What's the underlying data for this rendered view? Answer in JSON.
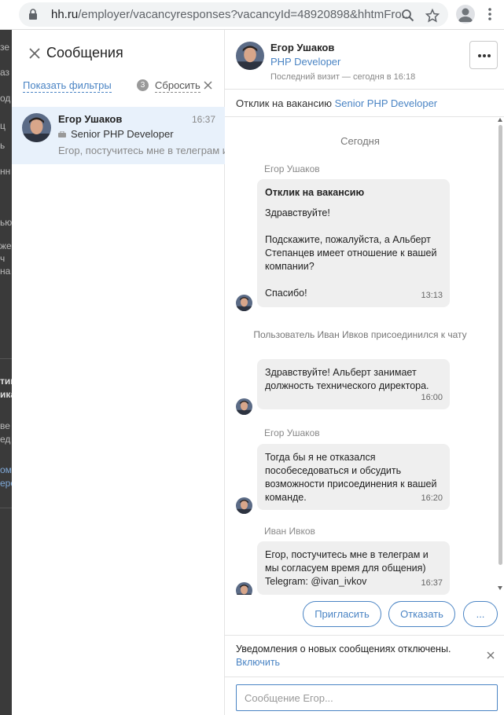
{
  "browser": {
    "url_host": "hh.ru",
    "url_path": "/employer/vacancyresponses?vacancyId=48920898&hhtmFro..."
  },
  "background_fragments": [
    "зе",
    "аз",
    "од",
    "ц",
    "ь",
    "нн",
    "ью",
    "жe",
    "ч",
    "на",
    "тик",
    "ика",
    "ве",
    "ед",
    "ом",
    "еро"
  ],
  "left_panel": {
    "title": "Сообщения",
    "filters_label": "Показать фильтры",
    "filters_count": "3",
    "reset_label": "Сбросить",
    "chats": [
      {
        "name": "Егор Ушаков",
        "time": "16:37",
        "vacancy": "Senior PHP Developer",
        "preview": "Егор, постучитесь мне в телеграм и мы согласуем время для общения)"
      }
    ]
  },
  "conversation": {
    "header": {
      "name": "Егор Ушаков",
      "position": "PHP Developer",
      "last_visit": "Последний визит — сегодня в 16:18"
    },
    "response_prefix": "Отклик на вакансию",
    "response_vacancy": "Senior PHP Developer",
    "day_label": "Сегодня",
    "messages": [
      {
        "sender": "Егор Ушаков",
        "title": "Отклик на вакансию",
        "lines": [
          "Здравствуйте!",
          "Подскажите, пожалуйста, а Альберт Степанцев имеет отношение к вашей компании?",
          "Спасибо!"
        ],
        "time": "13:13"
      },
      {
        "system": "Пользователь Иван Ивков присоединился к чату"
      },
      {
        "text": "Здравствуйте! Альберт занимает должность технического директора.",
        "time": "16:00"
      },
      {
        "sender": "Егор Ушаков",
        "text": "Тогда бы я не отказался пособеседоваться и обсудить возможности присоединения к вашей команде.",
        "time": "16:20"
      },
      {
        "sender": "Иван Ивков",
        "text": "Егор, постучитесь мне в телеграм и мы согласуем время для общения) Telegram: @ivan_ivkov",
        "time": "16:37"
      }
    ],
    "actions": {
      "invite": "Пригласить",
      "reject": "Отказать",
      "more": "..."
    },
    "notification": {
      "text": "Уведомления о новых сообщениях отключены.",
      "enable_link": "Включить"
    },
    "input": {
      "placeholder": "Сообщение Егор...",
      "value": ""
    }
  },
  "colors": {
    "accent": "#4a84c4",
    "selected_chat_bg": "#e8f1fb",
    "bubble_bg": "#efefef",
    "overlay_bg": "#3a3a3a"
  }
}
